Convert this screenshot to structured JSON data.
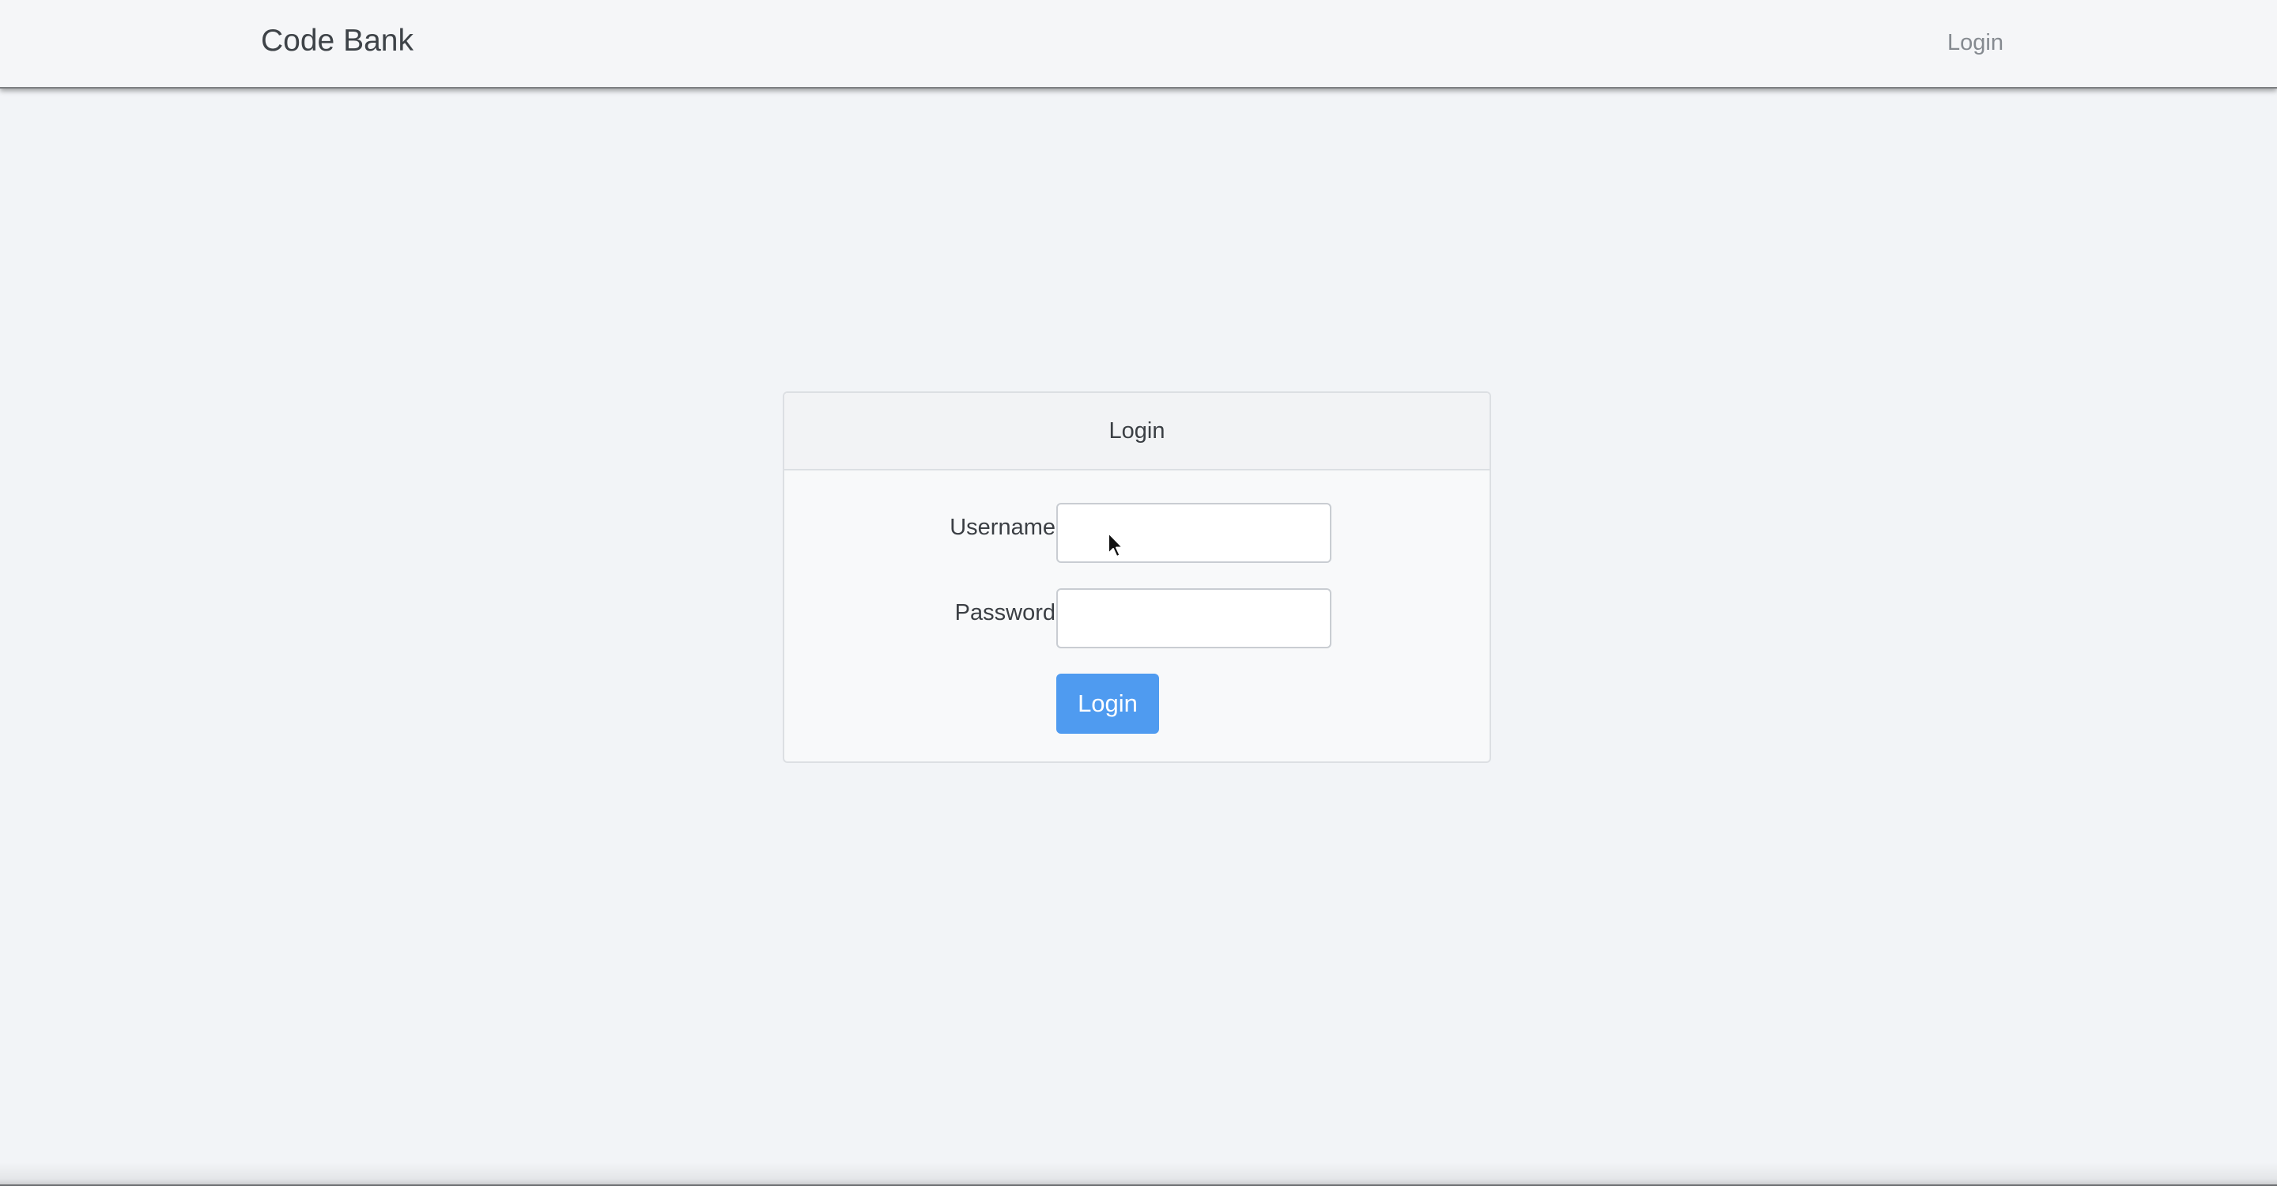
{
  "navbar": {
    "brand": "Code Bank",
    "login_link": "Login"
  },
  "login_panel": {
    "heading": "Login",
    "username_label": "Username",
    "username_value": "",
    "password_label": "Password",
    "password_value": "",
    "submit_label": "Login"
  },
  "colors": {
    "page_background": "#f2f4f7",
    "navbar_background": "#f5f6f8",
    "primary_button": "#4f9bf0",
    "nav_link": "#858a90"
  },
  "icons": {
    "cursor": "mouse-pointer-icon"
  }
}
